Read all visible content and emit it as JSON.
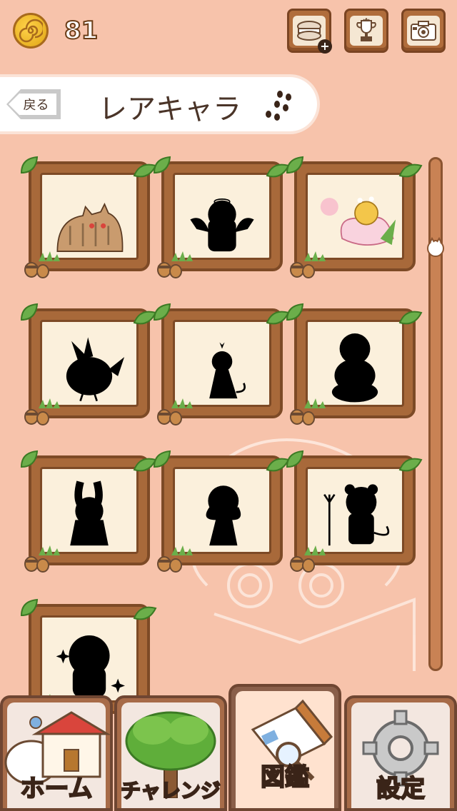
{
  "header": {
    "coins": "81",
    "buttons": [
      {
        "icon": "macaron-add-icon"
      },
      {
        "icon": "trophy-icon"
      },
      {
        "icon": "camera-icon"
      }
    ]
  },
  "banner": {
    "back_label": "戻る",
    "title": "レアキャラ"
  },
  "cards": [
    {
      "icon": "cat-character",
      "unlocked": true
    },
    {
      "icon": "angel-silhouette",
      "unlocked": false
    },
    {
      "icon": "flower-fairy-character",
      "unlocked": true
    },
    {
      "icon": "bird-silhouette",
      "unlocked": false
    },
    {
      "icon": "princess-silhouette",
      "unlocked": false
    },
    {
      "icon": "snowman-silhouette",
      "unlocked": false
    },
    {
      "icon": "rabbit-silhouette",
      "unlocked": false
    },
    {
      "icon": "girl-silhouette",
      "unlocked": false
    },
    {
      "icon": "devil-bear-silhouette",
      "unlocked": false
    },
    {
      "icon": "sparkle-silhouette",
      "unlocked": false
    }
  ],
  "nav": {
    "home": "ホーム",
    "challenge": "チャレンジ",
    "encyclopedia": "図鑑",
    "settings": "設定"
  },
  "colors": {
    "background": "#f7c3ab",
    "wood": "#a8693a",
    "wood_dark": "#7d4a26",
    "card_inner": "#fbf0dc"
  }
}
